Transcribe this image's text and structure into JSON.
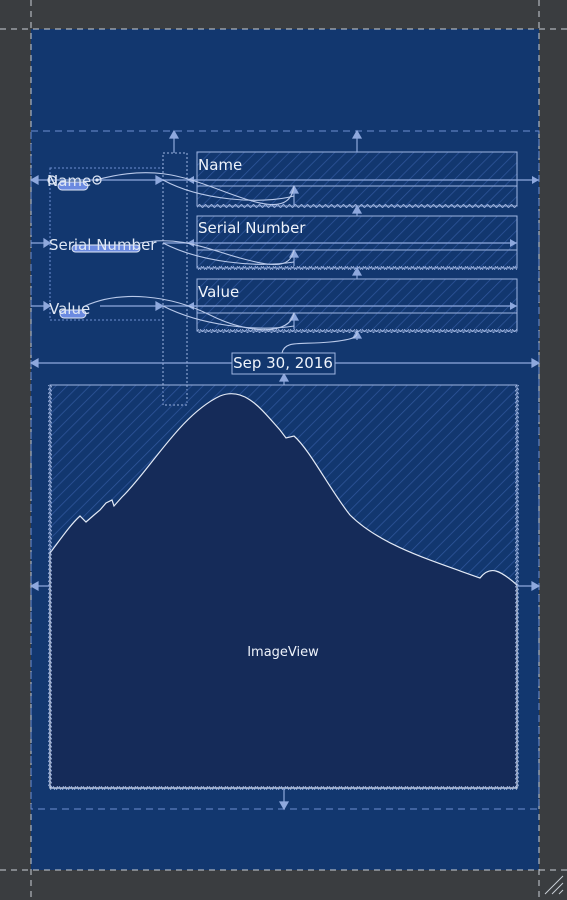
{
  "canvas": {
    "background": "#3a3d40",
    "scene_background": "#12376f",
    "guide_color": "#6f8fd0",
    "outline_color": "#d8e2f2"
  },
  "form": {
    "name_label": "Name",
    "serial_label": "Serial Number",
    "value_label": "Value",
    "name_placeholder": "Name",
    "serial_placeholder": "Serial Number",
    "value_placeholder": "Value"
  },
  "date_label": "Sep 30, 2016",
  "image_view": {
    "label": "ImageView",
    "fill_color": "#152b59"
  },
  "icons": {
    "resize_handle": "resize-corner-icon"
  }
}
